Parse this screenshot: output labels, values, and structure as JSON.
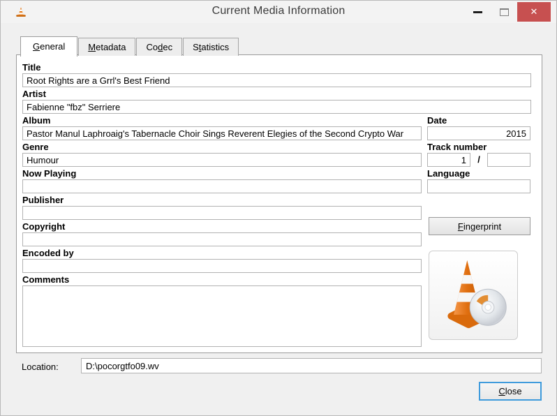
{
  "window": {
    "title": "Current Media Information"
  },
  "icons": {
    "close_glyph": "✕"
  },
  "tabs": [
    {
      "id": "general",
      "label": "&General",
      "active": true
    },
    {
      "id": "metadata",
      "label": "&Metadata",
      "active": false
    },
    {
      "id": "codec",
      "label": "Co&dec",
      "active": false
    },
    {
      "id": "statistics",
      "label": "S&tatistics",
      "active": false
    }
  ],
  "fields": {
    "title": {
      "label": "Title",
      "value": "Root Rights are a Grrl's Best Friend"
    },
    "artist": {
      "label": "Artist",
      "value": "Fabienne \"fbz\" Serriere"
    },
    "album": {
      "label": "Album",
      "value": "Pastor Manul Laphroaig's Tabernacle Choir Sings Reverent Elegies of the Second Crypto War"
    },
    "date": {
      "label": "Date",
      "value": "2015"
    },
    "genre": {
      "label": "Genre",
      "value": "Humour"
    },
    "track_number": {
      "label": "Track number",
      "value": "1",
      "separator": "/",
      "total": ""
    },
    "now_playing": {
      "label": "Now Playing",
      "value": ""
    },
    "language": {
      "label": "Language",
      "value": ""
    },
    "publisher": {
      "label": "Publisher",
      "value": ""
    },
    "copyright": {
      "label": "Copyright",
      "value": ""
    },
    "encoded_by": {
      "label": "Encoded by",
      "value": ""
    },
    "comments": {
      "label": "Comments",
      "value": ""
    }
  },
  "buttons": {
    "fingerprint": "&Fingerprint",
    "close": "&Close"
  },
  "location": {
    "label": "Location:",
    "value": "D:\\pocorgtfo09.wv"
  },
  "colors": {
    "window_bg": "#f0f0f0",
    "panel_bg": "#ffffff",
    "border_gray": "#9b9b9b",
    "input_border": "#b2b2b2",
    "titlebar_close_red": "#c75050",
    "default_button_border": "#3f9bdc",
    "vlc_orange": "#e57c1b"
  }
}
